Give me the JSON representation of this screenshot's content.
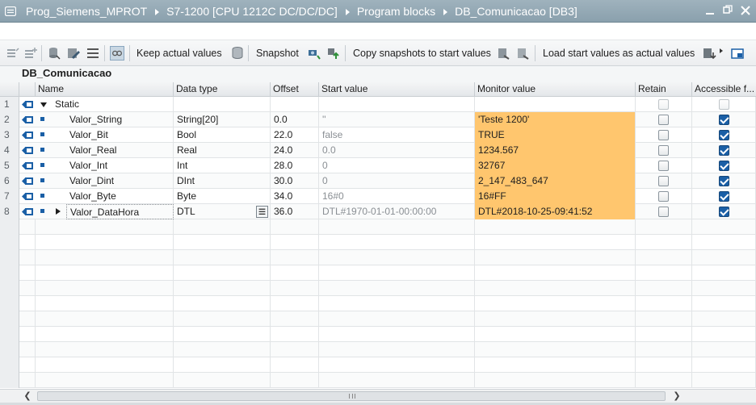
{
  "breadcrumb": [
    "Prog_Siemens_MPROT",
    "S7-1200 [CPU 1212C DC/DC/DC]",
    "Program blocks",
    "DB_Comunicacao [DB3]"
  ],
  "toolbar": {
    "keep_actual_values": "Keep actual values",
    "snapshot": "Snapshot",
    "copy_snapshots": "Copy snapshots to start values",
    "load_start_values": "Load start values as actual values"
  },
  "block_title": "DB_Comunicacao",
  "columns": [
    "Name",
    "Data type",
    "Offset",
    "Start value",
    "Monitor value",
    "Retain",
    "Accessible f..."
  ],
  "rows": [
    {
      "num": "1",
      "name": "Static",
      "type": "",
      "offset": "",
      "start": "",
      "monitor": "",
      "retain": false,
      "accessible": false
    },
    {
      "num": "2",
      "name": "Valor_String",
      "type": "String[20]",
      "offset": "0.0",
      "start": "''",
      "monitor": "'Teste 1200'",
      "retain": false,
      "accessible": true
    },
    {
      "num": "3",
      "name": "Valor_Bit",
      "type": "Bool",
      "offset": "22.0",
      "start": "false",
      "monitor": "TRUE",
      "retain": false,
      "accessible": true
    },
    {
      "num": "4",
      "name": "Valor_Real",
      "type": "Real",
      "offset": "24.0",
      "start": "0.0",
      "monitor": "1234.567",
      "retain": false,
      "accessible": true
    },
    {
      "num": "5",
      "name": "Valor_Int",
      "type": "Int",
      "offset": "28.0",
      "start": "0",
      "monitor": "32767",
      "retain": false,
      "accessible": true
    },
    {
      "num": "6",
      "name": "Valor_Dint",
      "type": "DInt",
      "offset": "30.0",
      "start": "0",
      "monitor": "2_147_483_647",
      "retain": false,
      "accessible": true
    },
    {
      "num": "7",
      "name": "Valor_Byte",
      "type": "Byte",
      "offset": "34.0",
      "start": "16#0",
      "monitor": "16#FF",
      "retain": false,
      "accessible": true
    },
    {
      "num": "8",
      "name": "Valor_DataHora",
      "type": "DTL",
      "offset": "36.0",
      "start": "DTL#1970-01-01-00:00:00",
      "monitor": "DTL#2018-10-25-09:41:52",
      "retain": false,
      "accessible": true
    }
  ],
  "colors": {
    "monitor_bg": "#ffc66e",
    "titlebar": "#8fa4b1",
    "accent": "#1a5fa6"
  }
}
